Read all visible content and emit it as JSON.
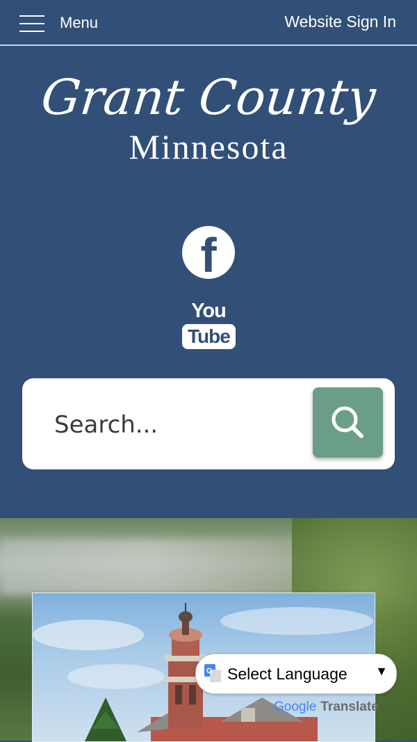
{
  "topbar": {
    "menu_label": "Menu",
    "signin_label": "Website Sign In"
  },
  "logo": {
    "script_text": "Grant County",
    "state_text": "Minnesota"
  },
  "social": {
    "facebook_glyph": "f",
    "youtube_top": "You",
    "youtube_bottom": "Tube"
  },
  "search": {
    "placeholder": "Search..."
  },
  "translate": {
    "selected_language": "Select Language",
    "powered_by_google": "Google",
    "powered_by_translate": "Translate"
  },
  "icons": {
    "menu": "hamburger-icon",
    "search": "search-icon",
    "facebook": "facebook-icon",
    "youtube": "youtube-icon",
    "translate": "google-translate-icon",
    "caret": "chevron-down-icon"
  },
  "colors": {
    "brand_blue": "#324f77",
    "search_button_green": "#6b9e88",
    "white": "#ffffff"
  }
}
